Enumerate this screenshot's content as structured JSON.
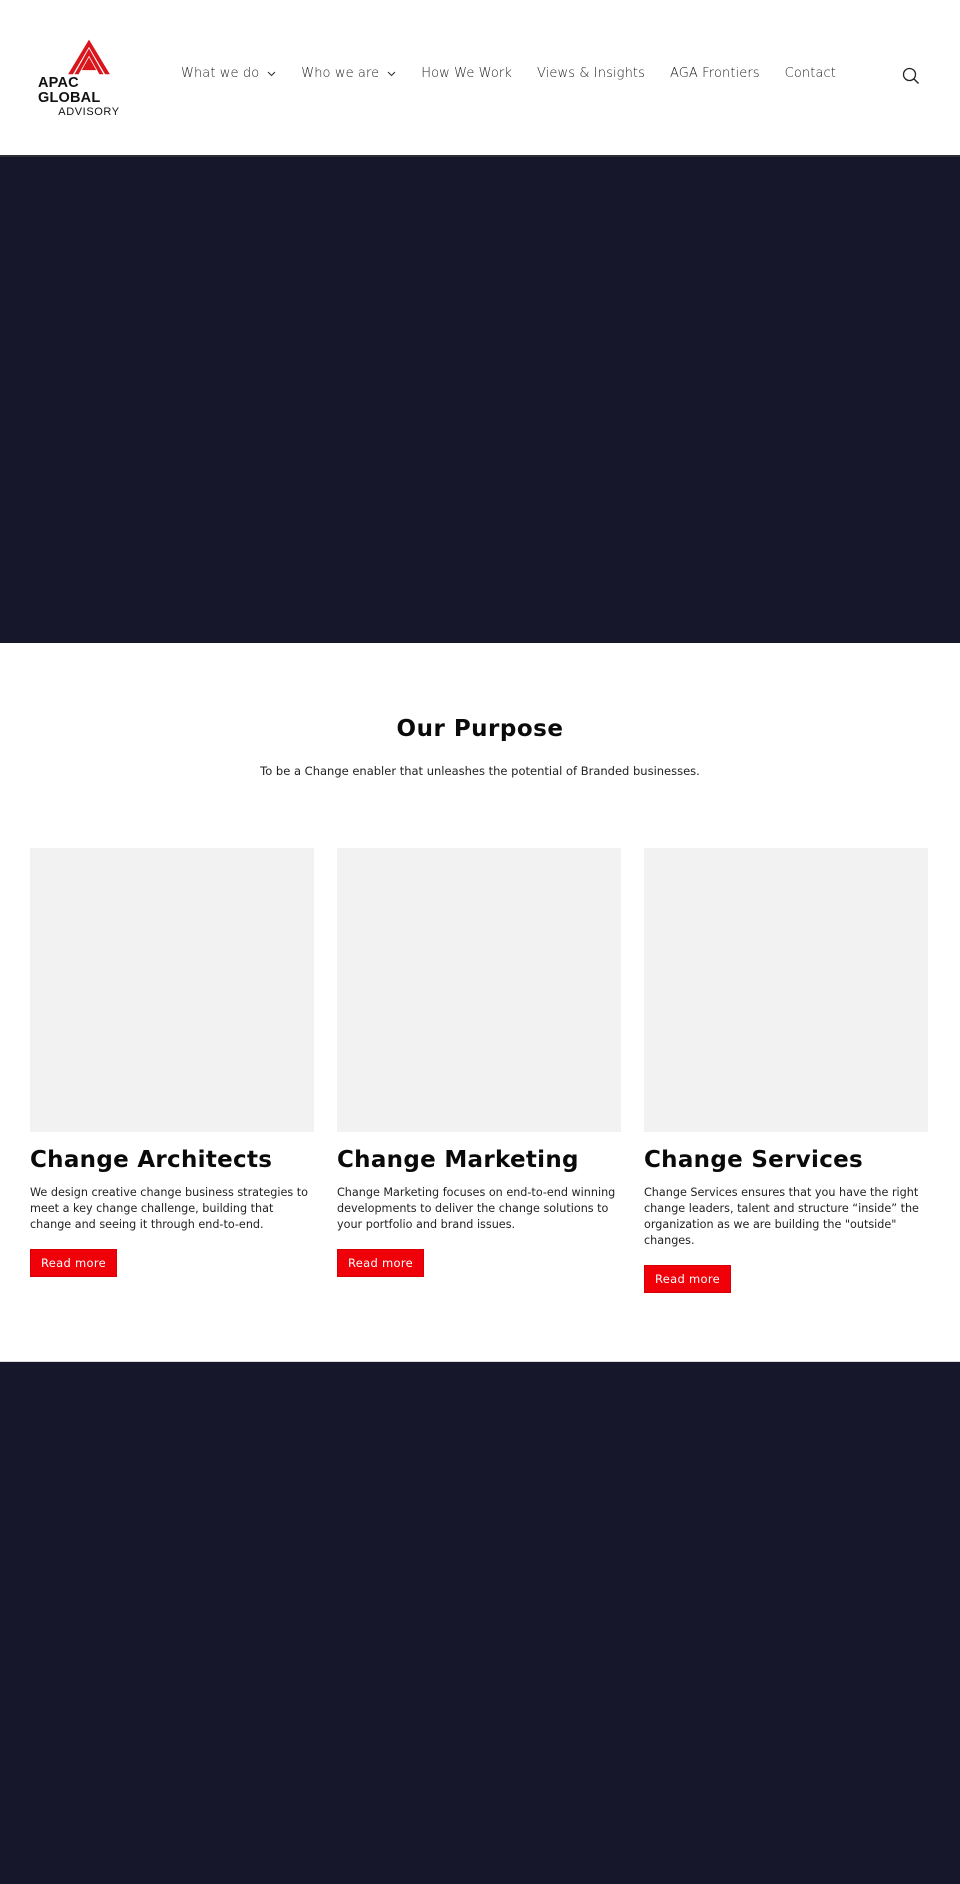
{
  "header": {
    "logo": {
      "line1": "APAC GLOBAL",
      "line2": "ADVISORY",
      "icon": "triangle-chevron-logo-icon",
      "accent_color": "#d9161c"
    },
    "nav": [
      {
        "label": "What we do",
        "has_dropdown": true
      },
      {
        "label": "Who we are",
        "has_dropdown": true
      },
      {
        "label": "How We Work",
        "has_dropdown": false
      },
      {
        "label": "Views & Insights",
        "has_dropdown": false
      },
      {
        "label": "AGA Frontiers",
        "has_dropdown": false
      },
      {
        "label": "Contact",
        "has_dropdown": false
      }
    ],
    "search_icon": "search-icon"
  },
  "hero": {
    "background_color": "#16172a"
  },
  "purpose": {
    "title": "Our Purpose",
    "text": "To be a Change enabler that unleashes the potential of Branded businesses."
  },
  "cards": [
    {
      "title": "Change Architects",
      "text": "We design creative change business strategies to meet a key change challenge, building that change and seeing it through end-to-end.",
      "button": "Read more"
    },
    {
      "title": "Change Marketing",
      "text": "Change Marketing focuses on end-to-end winning developments to deliver the change solutions to your portfolio and brand issues.",
      "button": "Read more"
    },
    {
      "title": "Change Services",
      "text": "Change Services ensures that you have the right change leaders, talent and structure “inside” the organization as we are building the \"outside\" changes.",
      "button": "Read more"
    }
  ],
  "colors": {
    "accent": "#f00008",
    "dark_band": "#16172a",
    "card_placeholder": "#f2f2f2"
  }
}
